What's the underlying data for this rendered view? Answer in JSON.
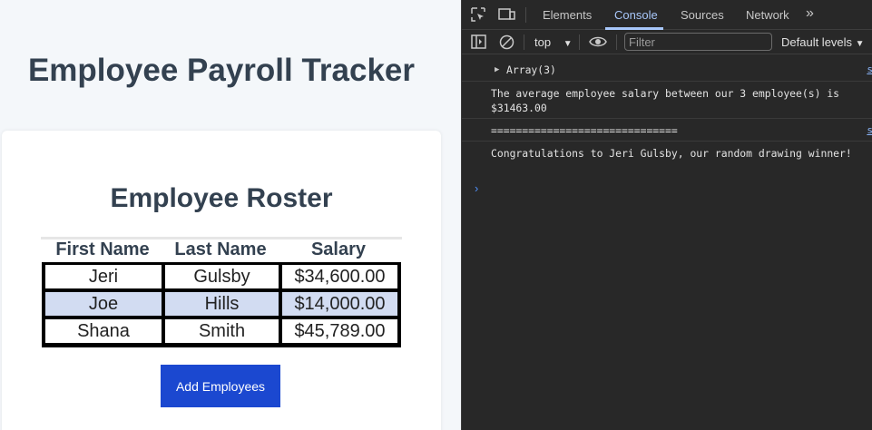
{
  "app": {
    "title": "Employee Payroll Tracker",
    "roster_title": "Employee Roster",
    "columns": [
      "First Name",
      "Last Name",
      "Salary"
    ],
    "rows": [
      [
        "Jeri",
        "Gulsby",
        "$34,600.00"
      ],
      [
        "Joe",
        "Hills",
        "$14,000.00"
      ],
      [
        "Shana",
        "Smith",
        "$45,789.00"
      ]
    ],
    "add_button": "Add Employees",
    "colors": {
      "button": "#1b48d0",
      "row_alt": "#d2dcf2",
      "heading": "#334150"
    }
  },
  "devtools": {
    "tabs": [
      "Elements",
      "Console",
      "Sources",
      "Network"
    ],
    "active_tab": "Console",
    "more_tabs_icon": "chevron-double-right-icon",
    "toolbar": {
      "context": "top",
      "filter_placeholder": "Filter",
      "levels": "Default levels"
    },
    "logs": [
      {
        "text": "Array(3)",
        "source": "s"
      },
      {
        "text": "The average employee salary between our 3 employee(s) is $31463.00",
        "source": ""
      },
      {
        "text": "==============================",
        "source": "s"
      },
      {
        "text": "Congratulations to Jeri Gulsby, our random drawing winner!",
        "source": ""
      }
    ],
    "prompt_symbol": "›"
  }
}
